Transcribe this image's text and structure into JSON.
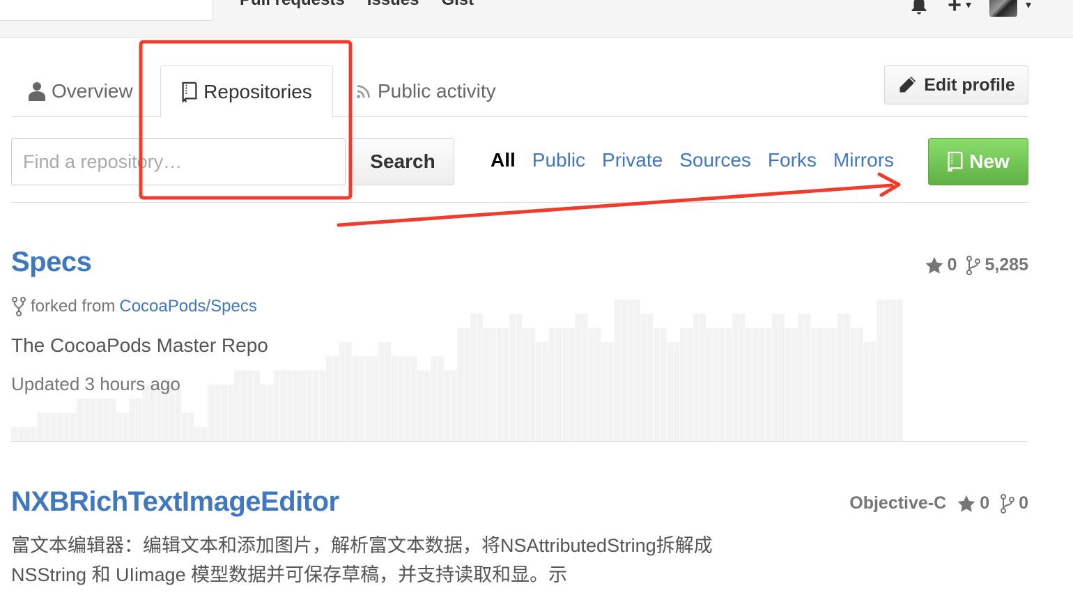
{
  "header": {
    "nav": [
      "Pull requests",
      "Issues",
      "Gist"
    ]
  },
  "profile_tabs": {
    "overview": "Overview",
    "repositories": "Repositories",
    "public_activity": "Public activity"
  },
  "edit_profile_label": "Edit profile",
  "filter_bar": {
    "search_placeholder": "Find a repository…",
    "search_button": "Search",
    "filters": [
      "All",
      "Public",
      "Private",
      "Sources",
      "Forks",
      "Mirrors"
    ],
    "active_filter": "All",
    "new_button": "New"
  },
  "repos": [
    {
      "name": "Specs",
      "forked_prefix": "forked from",
      "forked_from": "CocoaPods/Specs",
      "description": "The CocoaPods Master Repo",
      "updated": "Updated 3 hours ago",
      "stars": "0",
      "forks": "5,285",
      "activity": [
        1,
        1,
        1,
        1,
        2,
        2,
        2,
        2,
        2,
        2,
        3,
        3,
        3,
        3,
        3,
        3,
        2,
        2,
        3,
        3,
        4,
        4,
        4,
        4,
        4,
        4,
        2,
        2,
        1,
        1,
        4,
        4,
        4,
        4,
        5,
        5,
        5,
        5,
        4,
        4,
        5,
        5,
        5,
        5,
        5,
        5,
        5,
        5,
        6,
        6,
        7,
        7,
        6,
        6,
        6,
        6,
        7,
        7,
        6,
        6,
        6,
        6,
        5,
        5,
        6,
        6,
        5,
        5,
        8,
        8,
        9,
        9,
        8,
        8,
        8,
        8,
        9,
        9,
        8,
        8,
        7,
        7,
        8,
        8,
        8,
        8,
        9,
        9,
        8,
        8,
        7,
        7,
        10,
        10,
        10,
        10,
        9,
        9,
        8,
        8,
        7,
        7,
        8,
        8,
        9,
        9,
        8,
        8,
        8,
        8,
        9,
        9,
        8,
        8,
        8,
        8,
        9,
        9,
        8,
        8,
        9,
        9,
        8,
        8,
        8,
        8,
        9,
        9,
        8,
        8,
        7,
        7,
        10,
        10,
        10,
        10
      ]
    },
    {
      "name": "NXBRichTextImageEditor",
      "language": "Objective-C",
      "stars": "0",
      "forks": "0",
      "description": "富文本编辑器：编辑文本和添加图片，解析富文本数据，将NSAttributedString拆解成 NSString 和 UIimage 模型数据并可保存草稿，并支持读取和显。示"
    }
  ],
  "colors": {
    "link": "#4078c0",
    "new_button": "#6cc644",
    "annotation": "#f03c2d"
  }
}
